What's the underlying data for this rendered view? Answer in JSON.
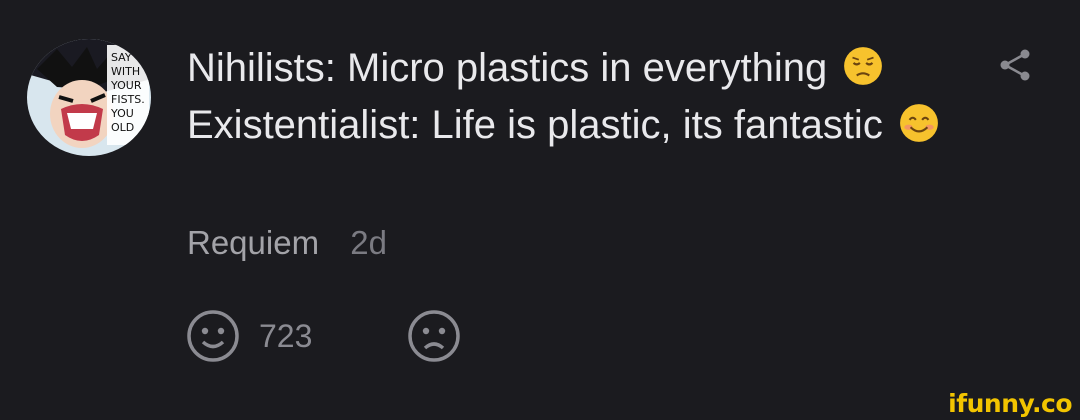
{
  "post": {
    "text_part1": "Nihilists: Micro plastics in everything",
    "text_part2": "Existentialist: Life is plastic, its fantastic",
    "emoji1": "pensive-face",
    "emoji2": "smiling-face"
  },
  "avatar": {
    "alt": "manga character avatar",
    "speech_bubble_text": "SAY WITH YOUR FISTS. YOU OLD"
  },
  "author": {
    "name": "Requiem",
    "time": "2d"
  },
  "reactions": {
    "like_count": "723",
    "like_icon": "smile-icon",
    "dislike_icon": "frown-icon"
  },
  "share_icon": "share-icon",
  "watermark": "ifunny.co",
  "colors": {
    "background": "#1b1b1f",
    "text": "#e9e9ec",
    "muted": "#a3a3a8",
    "watermark": "#f2c400"
  }
}
